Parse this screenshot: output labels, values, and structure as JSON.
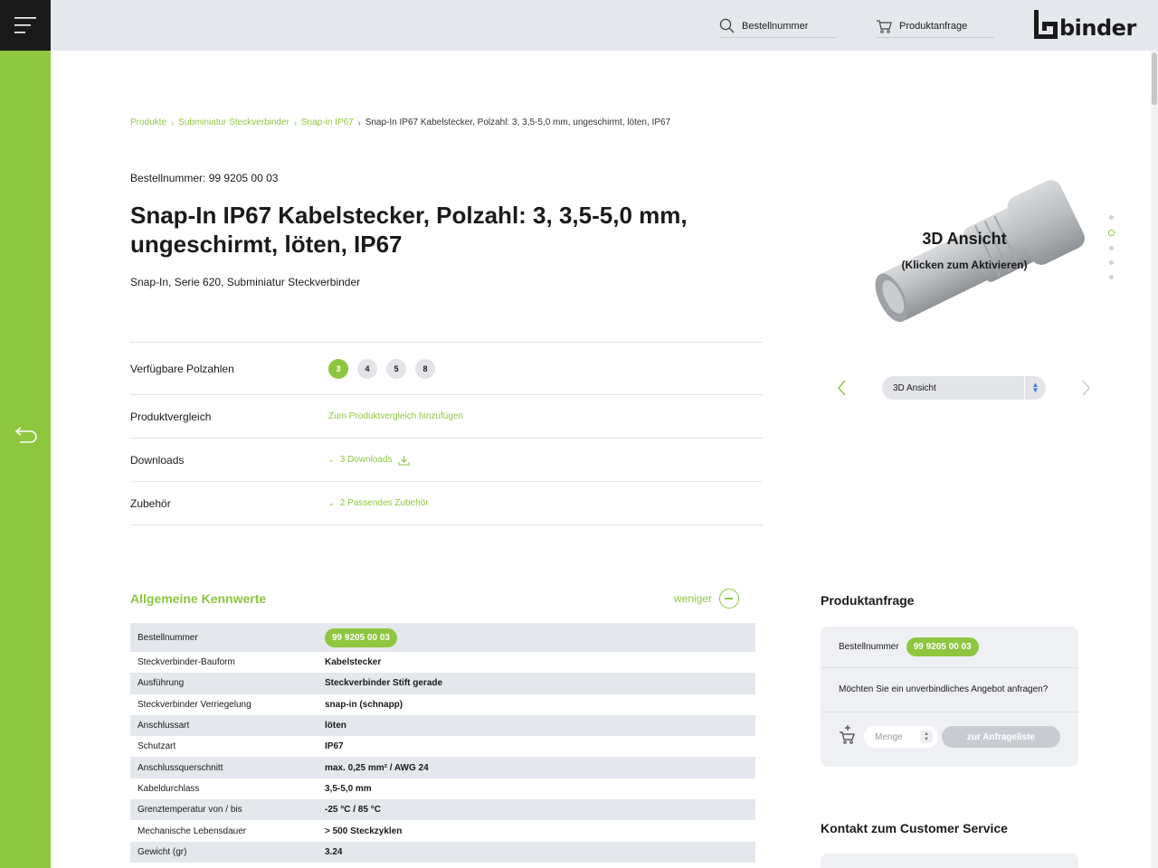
{
  "header": {
    "search_label": "Bestellnummer",
    "request_label": "Produktanfrage",
    "logo_text": "binder"
  },
  "breadcrumb": {
    "items": [
      "Produkte",
      "Subminiatur Steckverbinder",
      "Snap-in IP67"
    ],
    "current": "Snap-In IP67 Kabelstecker, Polzahl: 3, 3,5-5,0 mm, ungeschirmt, löten, IP67"
  },
  "product": {
    "order_number_line": "Bestellnummer: 99 9205 00 03",
    "title": "Snap-In IP67 Kabelstecker, Polzahl: 3, 3,5-5,0 mm, ungeschirmt, löten, IP67",
    "subtitle": "Snap-In, Serie 620, Subminiatur Steckverbinder"
  },
  "attributes": {
    "pins_label": "Verfügbare Polzahlen",
    "pins": [
      "3",
      "4",
      "5",
      "8"
    ],
    "pins_active": "3",
    "compare_label": "Produktvergleich",
    "compare_link": "Zum Produktvergleich hinzufügen",
    "downloads_label": "Downloads",
    "downloads_link": "3 Downloads",
    "accessories_label": "Zubehör",
    "accessories_link": "2 Passendes Zubehör"
  },
  "gallery": {
    "overlay_title": "3D Ansicht",
    "overlay_subtitle": "(Klicken zum Aktivieren)",
    "view_select": "3D Ansicht",
    "dots": 5,
    "active_dot": 2
  },
  "general": {
    "title": "Allgemeine Kennwerte",
    "less_label": "weniger",
    "rows": [
      {
        "key": "Bestellnummer",
        "value": "99 9205 00 03",
        "badge": true
      },
      {
        "key": "Steckverbinder-Bauform",
        "value": "Kabelstecker"
      },
      {
        "key": "Ausführung",
        "value": "Steckverbinder Stift gerade"
      },
      {
        "key": "Steckverbinder Verriegelung",
        "value": "snap-in (schnapp)"
      },
      {
        "key": "Anschlussart",
        "value": "löten"
      },
      {
        "key": "Schutzart",
        "value": "IP67"
      },
      {
        "key": "Anschlussquerschnitt",
        "value": "max. 0,25 mm² / AWG 24"
      },
      {
        "key": "Kabeldurchlass",
        "value": "3,5-5,0 mm"
      },
      {
        "key": "Grenztemperatur von / bis",
        "value": "-25 °C / 85 °C"
      },
      {
        "key": "Mechanische Lebensdauer",
        "value": "> 500 Steckzyklen"
      },
      {
        "key": "Gewicht (gr)",
        "value": "3.24"
      }
    ]
  },
  "request": {
    "title": "Produktanfrage",
    "order_label": "Bestellnummer",
    "order_value": "99 9205 00 03",
    "question": "Möchten Sie ein unverbindliches Angebot anfragen?",
    "qty_placeholder": "Menge",
    "add_button": "zur Anfrageliste"
  },
  "customer_service": {
    "title": "Kontakt zum Customer Service"
  },
  "colors": {
    "accent": "#8dc63f",
    "header_bg": "#e4e7ec",
    "menu_bg": "#1a1a1a"
  }
}
